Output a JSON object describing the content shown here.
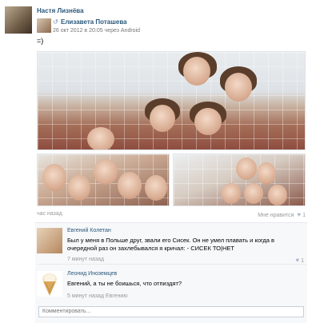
{
  "post": {
    "author_name": "Настя Лизнёва",
    "repost": {
      "name": "Елизавета Поташева",
      "date": "26 окт 2012 в 20:05 через Android"
    },
    "text": "=)",
    "time": "час назад",
    "like_label": "Мне нравится",
    "like_count": "1"
  },
  "comments": [
    {
      "name": "Евгений Колетан",
      "text": "Был у меня в Польше друг, звали его Сисек. Он не умел плавать и когда в очередной раз он захлебывался я кричал: - СИСЕК ТО|НЕТ",
      "time": "7 минут назад",
      "like_count": "1"
    },
    {
      "name": "Леонид Иноземцев",
      "text": "Евгений, а ты не боишься, что отпиздят?",
      "time": "5 минут назад Евгению"
    }
  ],
  "comment_input": {
    "placeholder": "Комментировать..."
  },
  "icons": {
    "repost": "repost-icon",
    "heart": "heart-icon",
    "ice_cream": "ice-cream-icon"
  },
  "colors": {
    "link": "#2b587a",
    "muted": "#999999",
    "comments_bg": "#f7f8fa"
  }
}
